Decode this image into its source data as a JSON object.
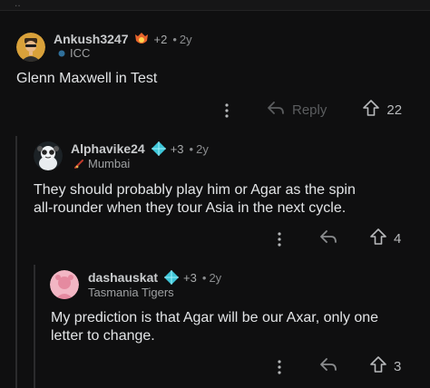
{
  "comments": [
    {
      "username": "Ankush3247",
      "badge_icon": "fire-shield-badge-icon",
      "plus_badges": "+2",
      "age": "2y",
      "flair_icon": "icc-icon",
      "flair": "ICC",
      "body": "Glenn Maxwell in Test",
      "reply_label": "Reply",
      "votes": "22"
    },
    {
      "username": "Alphavike24",
      "badge_icon": "diamond-badge-icon",
      "plus_badges": "+3",
      "age": "2y",
      "flair_icon": "mumbai-icon",
      "flair": "Mumbai",
      "body_lines": [
        "They should probably play him or Agar as the spin",
        "all-rounder when they tour Asia in the next cycle."
      ],
      "votes": "4"
    },
    {
      "username": "dashauskat",
      "badge_icon": "diamond-badge-icon",
      "plus_badges": "+3",
      "age": "2y",
      "flair": "Tasmania Tigers",
      "body_lines": [
        "My prediction is that Agar will be our Axar, only one",
        "letter to change."
      ],
      "votes": "3"
    }
  ],
  "separator": "•",
  "colors": {
    "background": "#0f0f10",
    "diamond": "#3ec6d8",
    "fire_badge": "#e8642c",
    "thread_line": "#2b2b2d"
  }
}
